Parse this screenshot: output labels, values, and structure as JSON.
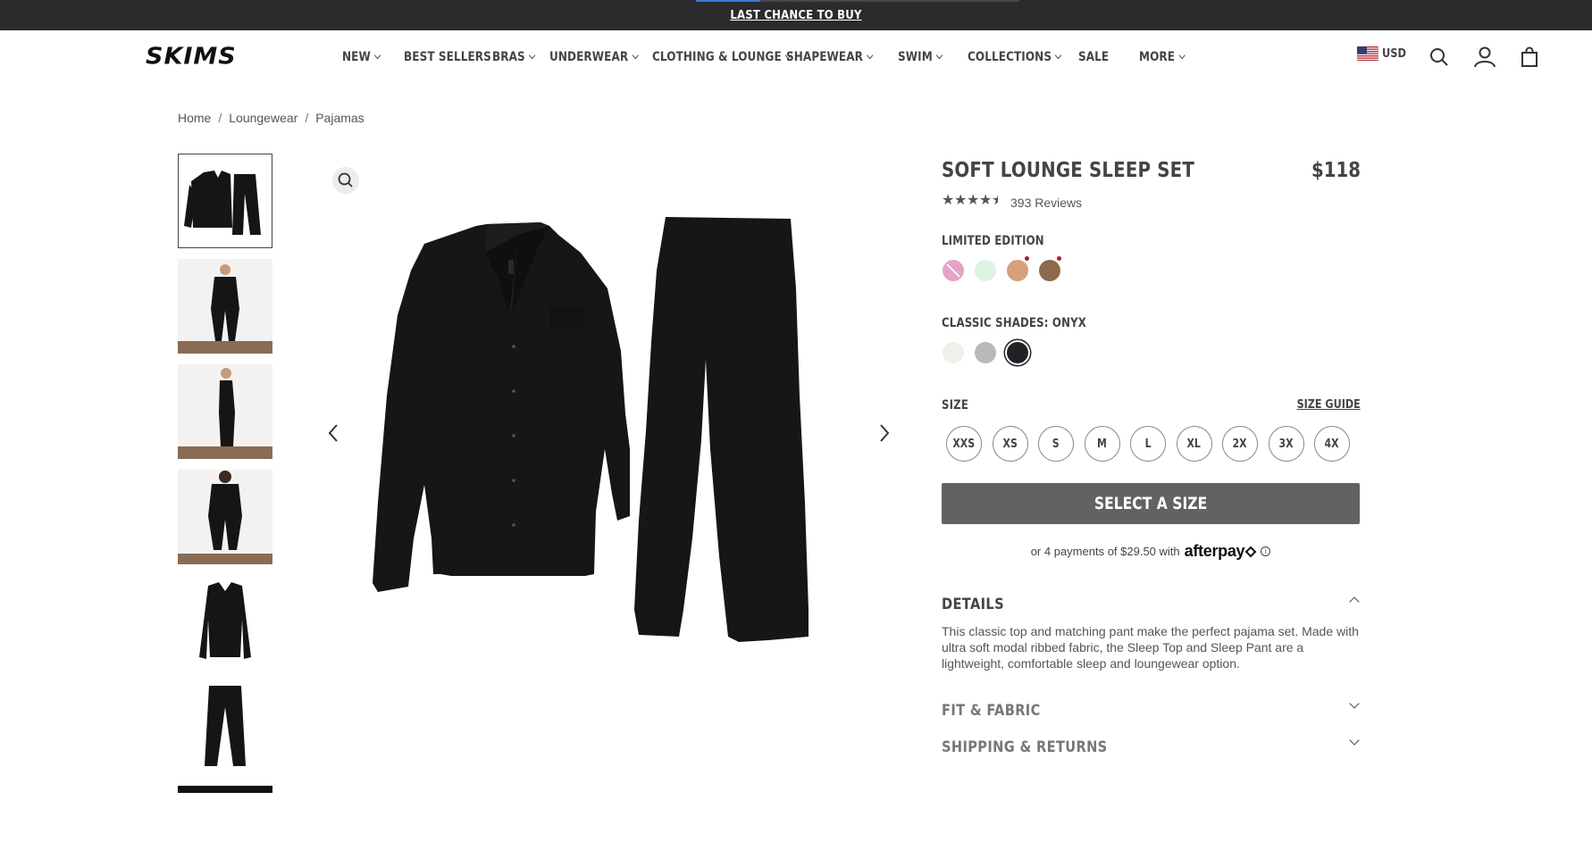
{
  "promo": {
    "text": "LAST CHANCE TO BUY",
    "progress_fraction": 0.2
  },
  "header": {
    "logo": "SKIMS",
    "nav": [
      {
        "label": "NEW",
        "dropdown": true
      },
      {
        "label": "BEST SELLERS",
        "dropdown": false
      },
      {
        "label": "BRAS",
        "dropdown": true
      },
      {
        "label": "UNDERWEAR",
        "dropdown": true
      },
      {
        "label": "CLOTHING & LOUNGE",
        "dropdown": true
      },
      {
        "label": "SHAPEWEAR",
        "dropdown": true
      },
      {
        "label": "SWIM",
        "dropdown": true
      },
      {
        "label": "COLLECTIONS",
        "dropdown": true
      },
      {
        "label": "SALE",
        "dropdown": false
      },
      {
        "label": "MORE",
        "dropdown": true
      }
    ],
    "currency": "USD",
    "icons": [
      "us-flag-icon",
      "search-icon",
      "account-icon",
      "bag-icon"
    ]
  },
  "breadcrumb": [
    "Home",
    "Loungewear",
    "Pajamas"
  ],
  "gallery": {
    "thumbnails": [
      "flat-lay-set",
      "model-front",
      "model-side",
      "model-front-closeup",
      "top-flat",
      "pant-flat"
    ],
    "active_index": 0
  },
  "product": {
    "title": "SOFT LOUNGE SLEEP SET",
    "price": "$118",
    "rating": 4.5,
    "reviews": "393 Reviews",
    "limited_label": "LIMITED EDITION",
    "limited_swatches": [
      {
        "color": "#e7a2c7",
        "unavailable": true,
        "dot": false
      },
      {
        "color": "#dcf3e3",
        "unavailable": false,
        "dot": false
      },
      {
        "color": "#d5a07b",
        "unavailable": false,
        "dot": true
      },
      {
        "color": "#8d6a4c",
        "unavailable": false,
        "dot": true
      }
    ],
    "classic_label": "CLASSIC SHADES: ONYX",
    "classic_swatches": [
      {
        "color": "#f0f0ea",
        "selected": false
      },
      {
        "color": "#b9b9bc",
        "selected": false
      },
      {
        "color": "#222226",
        "selected": true
      }
    ],
    "size_label": "SIZE",
    "size_guide": "SIZE GUIDE",
    "sizes": [
      "XXS",
      "XS",
      "S",
      "M",
      "L",
      "XL",
      "2X",
      "3X",
      "4X"
    ],
    "cta": "SELECT A SIZE",
    "afterpay_text": "or 4 payments of $29.50 with",
    "afterpay_brand": "afterpay",
    "details_title": "DETAILS",
    "details_text": "This classic top and matching pant make the perfect pajama set. Made with ultra soft modal ribbed fabric, the Sleep Top and Sleep Pant are a lightweight, comfortable sleep and loungewear option.",
    "fit_title": "FIT & FABRIC",
    "shipping_title": "SHIPPING & RETURNS"
  },
  "colors": {
    "promo_bg": "#2b2b2e",
    "cta_bg": "#626262",
    "text": "#444444",
    "accent_blue": "#3a78d6"
  }
}
